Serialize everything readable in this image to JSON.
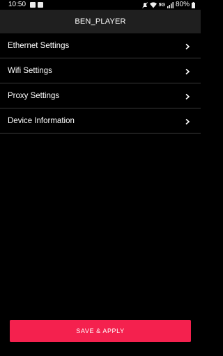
{
  "status_bar": {
    "time": "10:50",
    "network_label": "5G",
    "battery": "80%"
  },
  "app_bar": {
    "title": "BEN_PLAYER"
  },
  "menu": {
    "items": [
      {
        "label": "Ethernet Settings",
        "icon": "chevron-right-icon"
      },
      {
        "label": "Wifi Settings",
        "icon": "chevron-right-icon"
      },
      {
        "label": "Proxy Settings",
        "icon": "chevron-right-icon"
      },
      {
        "label": "Device Information",
        "icon": "chevron-right-icon"
      }
    ]
  },
  "actions": {
    "save_label": "SAVE & APPLY"
  },
  "colors": {
    "background": "#000000",
    "app_bar": "#1f1f1f",
    "accent": "#f4214e",
    "divider": "#3b3b3b"
  }
}
